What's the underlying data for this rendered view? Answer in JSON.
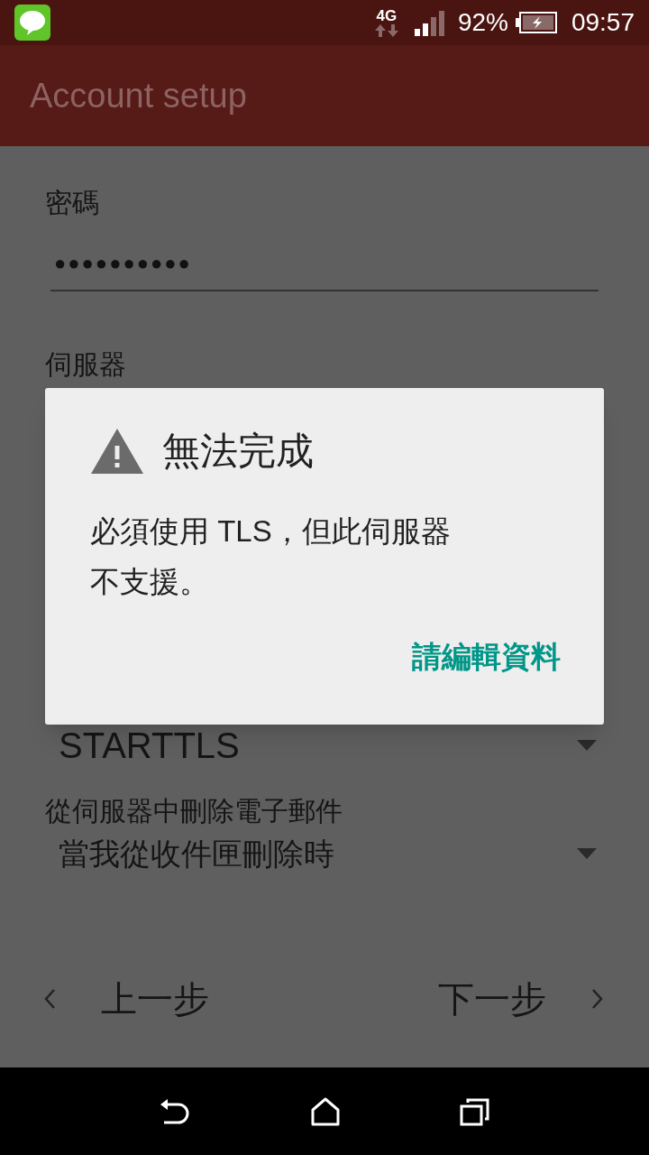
{
  "status_bar": {
    "network": "4G",
    "battery": "92%",
    "time": "09:57"
  },
  "app_bar": {
    "title": "Account setup"
  },
  "form": {
    "password": {
      "label": "密碼",
      "value": "●●●●●●●●●●"
    },
    "server": {
      "label": "伺服器"
    },
    "security": {
      "value": "STARTTLS"
    },
    "delete_policy": {
      "label": "從伺服器中刪除電子郵件",
      "value": "當我從收件匣刪除時"
    }
  },
  "nav_buttons": [
    {
      "label": "上一步",
      "kind": "back"
    },
    {
      "label": "下一步",
      "kind": "next"
    }
  ],
  "dialog": {
    "title": "無法完成",
    "message": "必須使用 TLS，但此伺服器不支援。",
    "action": "請編輯資料"
  }
}
